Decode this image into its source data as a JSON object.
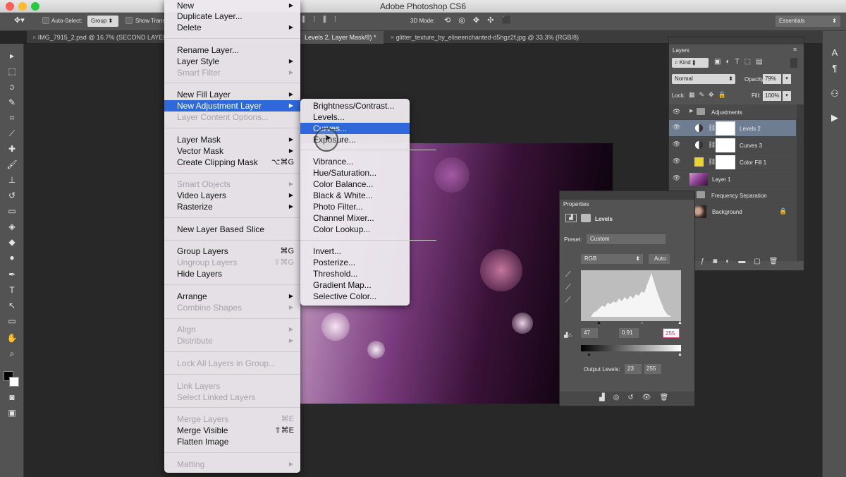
{
  "app": {
    "title": "Adobe Photoshop CS6"
  },
  "options_bar": {
    "auto_select": "Auto-Select:",
    "auto_select_value": "Group",
    "show_transform": "Show Trans",
    "mode_3d": "3D Mode:",
    "workspace": "Essentials"
  },
  "tabs": [
    {
      "label": "IMG_7915_2.psd @ 16.7% (SECOND LAYER"
    },
    {
      "label": "Levels 2, Layer Mask/8) *"
    },
    {
      "label": "glitter_texture_by_eliseenchanted-d5hgz2f.jpg @ 33.3% (RGB/8)"
    }
  ],
  "layer_menu": {
    "items": [
      {
        "label": "New",
        "submenu": true
      },
      {
        "label": "Duplicate Layer..."
      },
      {
        "label": "Delete",
        "submenu": true
      },
      {
        "label": "Rename Layer..."
      },
      {
        "label": "Layer Style",
        "submenu": true
      },
      {
        "label": "Smart Filter",
        "submenu": true,
        "disabled": true
      },
      {
        "label": "New Fill Layer",
        "submenu": true
      },
      {
        "label": "New Adjustment Layer",
        "submenu": true,
        "highlighted": true
      },
      {
        "label": "Layer Content Options...",
        "disabled": true
      },
      {
        "label": "Layer Mask",
        "submenu": true
      },
      {
        "label": "Vector Mask",
        "submenu": true
      },
      {
        "label": "Create Clipping Mask",
        "shortcut": "⌥⌘G"
      },
      {
        "label": "Smart Objects",
        "submenu": true,
        "disabled": true
      },
      {
        "label": "Video Layers",
        "submenu": true
      },
      {
        "label": "Rasterize",
        "submenu": true
      },
      {
        "label": "New Layer Based Slice"
      },
      {
        "label": "Group Layers",
        "shortcut": "⌘G"
      },
      {
        "label": "Ungroup Layers",
        "shortcut": "⇧⌘G",
        "disabled": true
      },
      {
        "label": "Hide Layers"
      },
      {
        "label": "Arrange",
        "submenu": true
      },
      {
        "label": "Combine Shapes",
        "submenu": true,
        "disabled": true
      },
      {
        "label": "Align",
        "submenu": true,
        "disabled": true
      },
      {
        "label": "Distribute",
        "submenu": true,
        "disabled": true
      },
      {
        "label": "Lock All Layers in Group...",
        "disabled": true
      },
      {
        "label": "Link Layers",
        "disabled": true
      },
      {
        "label": "Select Linked Layers",
        "disabled": true
      },
      {
        "label": "Merge Layers",
        "shortcut": "⌘E",
        "disabled": true
      },
      {
        "label": "Merge Visible",
        "shortcut": "⇧⌘E"
      },
      {
        "label": "Flatten Image"
      },
      {
        "label": "Matting",
        "submenu": true,
        "disabled": true
      }
    ]
  },
  "adjustment_submenu": {
    "items": [
      {
        "label": "Brightness/Contrast..."
      },
      {
        "label": "Levels..."
      },
      {
        "label": "Curves...",
        "highlighted": true
      },
      {
        "label": "Exposure..."
      },
      {
        "label": "Vibrance..."
      },
      {
        "label": "Hue/Saturation..."
      },
      {
        "label": "Color Balance..."
      },
      {
        "label": "Black & White..."
      },
      {
        "label": "Photo Filter..."
      },
      {
        "label": "Channel Mixer..."
      },
      {
        "label": "Color Lookup..."
      },
      {
        "label": "Invert..."
      },
      {
        "label": "Posterize..."
      },
      {
        "label": "Threshold..."
      },
      {
        "label": "Gradient Map..."
      },
      {
        "label": "Selective Color..."
      }
    ]
  },
  "layers_panel": {
    "title": "Layers",
    "kind": "Kind",
    "blend_mode": "Normal",
    "opacity_label": "Opacity:",
    "opacity": "79%",
    "lock_label": "Lock:",
    "fill_label": "Fill:",
    "fill": "100%",
    "layers": [
      {
        "name": "Adjustments",
        "type": "group"
      },
      {
        "name": "Levels 2",
        "type": "adjustment",
        "selected": true
      },
      {
        "name": "Curves 3",
        "type": "adjustment"
      },
      {
        "name": "Color Fill 1",
        "type": "fill"
      },
      {
        "name": "Layer 1",
        "type": "pixel"
      },
      {
        "name": "Frequency Separation",
        "type": "group"
      },
      {
        "name": "Background",
        "type": "background"
      }
    ]
  },
  "properties_panel": {
    "title": "Properties",
    "adjustment": "Levels",
    "preset_label": "Preset:",
    "preset": "Custom",
    "channel": "RGB",
    "auto": "Auto",
    "input_black": "47",
    "input_gamma": "0.91",
    "input_white": "255",
    "output_label": "Output Levels:",
    "output_black": "23",
    "output_white": "255"
  },
  "colors": {
    "menu_highlight": "#2f68d8",
    "selected_layer": "#6f7d93",
    "fill_swatch": "#e8d23a"
  }
}
